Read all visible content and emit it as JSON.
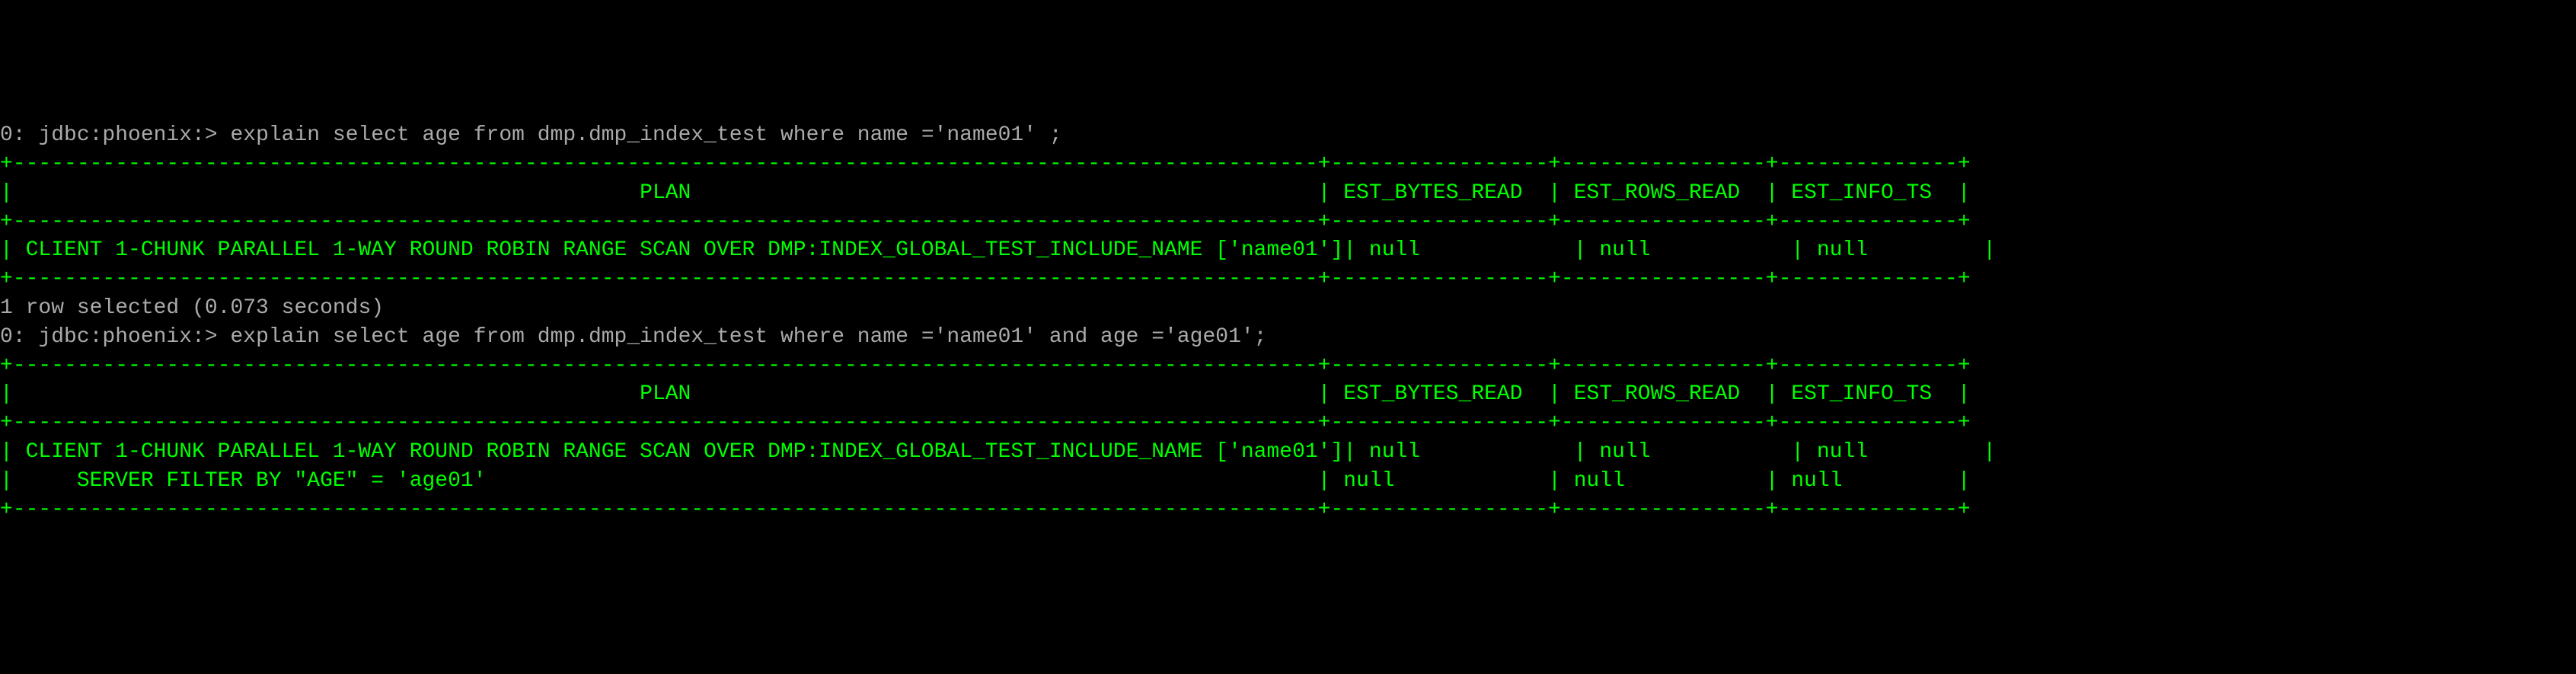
{
  "prompt_prefix": "0: jdbc:phoenix:>",
  "query1": "explain select age from dmp.dmp_index_test where name ='name01' ;",
  "query2": "explain select age from dmp.dmp_index_test where name ='name01' and age ='age01';",
  "row_selected_msg": "1 row selected (0.073 seconds)",
  "headers": {
    "plan": "PLAN",
    "est_bytes_read": "EST_BYTES_READ",
    "est_rows_read": "EST_ROWS_READ",
    "est_info_ts": "EST_INFO_TS"
  },
  "result1": {
    "plan": "CLIENT 1-CHUNK PARALLEL 1-WAY ROUND ROBIN RANGE SCAN OVER DMP:INDEX_GLOBAL_TEST_INCLUDE_NAME ['name01']",
    "est_bytes_read": "null",
    "est_rows_read": "null",
    "est_info_ts": "null"
  },
  "result2_rows": [
    {
      "plan": "CLIENT 1-CHUNK PARALLEL 1-WAY ROUND ROBIN RANGE SCAN OVER DMP:INDEX_GLOBAL_TEST_INCLUDE_NAME ['name01']",
      "est_bytes_read": "null",
      "est_rows_read": "null",
      "est_info_ts": "null"
    },
    {
      "plan": "    SERVER FILTER BY \"AGE\" = 'age01'",
      "est_bytes_read": "null",
      "est_rows_read": "null",
      "est_info_ts": "null"
    }
  ],
  "border": {
    "top": "+------------------------------------------------------------------------------------------------------+-----------------+----------------+--------------+",
    "header": "|                                                 PLAN                                                 | EST_BYTES_READ  | EST_ROWS_READ  | EST_INFO_TS  |",
    "mid": "+------------------------------------------------------------------------------------------------------+-----------------+----------------+--------------+",
    "bot": "+------------------------------------------------------------------------------------------------------+-----------------+----------------+--------------+"
  },
  "col_widths": {
    "plan": 102,
    "est_bytes_read": 17,
    "est_rows_read": 16,
    "est_info_ts": 14
  }
}
